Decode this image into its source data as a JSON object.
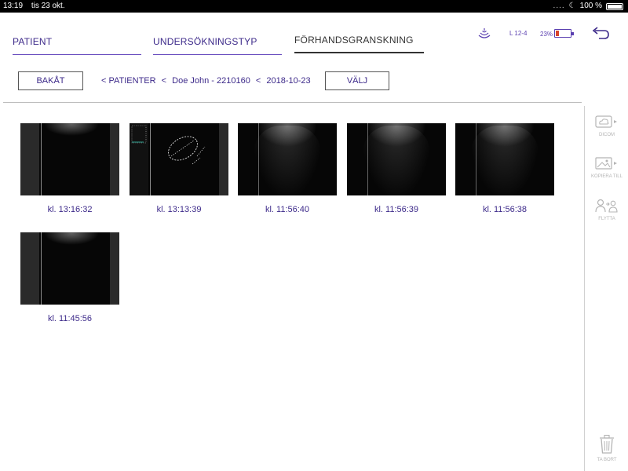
{
  "status_bar": {
    "time": "13:19",
    "date": "tis 23 okt.",
    "battery_pct": "100 %"
  },
  "tabs": [
    {
      "label": "PATIENT",
      "active": false
    },
    {
      "label": "UNDERSÖKNINGSTYP",
      "active": false
    },
    {
      "label": "FÖRHANDSGRANSKNING",
      "active": true
    }
  ],
  "header": {
    "probe": "L 12-4",
    "battery_pct": "23%",
    "battery_level": 0.23,
    "icons": [
      "signal-icon",
      "battery-icon",
      "back-undo-icon"
    ]
  },
  "toolbar": {
    "back_label": "BAKÅT",
    "select_label": "VÄLJ",
    "breadcrumb": [
      "< PATIENTER",
      "<",
      "Doe John - 2210160",
      "<",
      "2018-10-23"
    ]
  },
  "thumbnails": [
    {
      "caption": "kl. 13:16:32",
      "style": "dark"
    },
    {
      "caption": "kl. 13:13:39",
      "style": "annotated"
    },
    {
      "caption": "kl. 11:56:40",
      "style": "wide"
    },
    {
      "caption": "kl. 11:56:39",
      "style": "wide"
    },
    {
      "caption": "kl. 11:56:38",
      "style": "wide"
    },
    {
      "caption": "kl. 11:45:56",
      "style": "dark"
    }
  ],
  "sidebar": {
    "dicom_label": "DICOM",
    "copy_label": "KOPIERA TILL",
    "move_label": "FLYTTA",
    "delete_label": "TA BORT",
    "icons": [
      "cloud-icon",
      "image-icon",
      "users-icon",
      "trash-icon"
    ]
  },
  "colors": {
    "accent": "#3d2a8a",
    "tab_underline": "#6a4fbf",
    "battery_low": "#d9432a",
    "disabled": "#b4b4b4"
  }
}
